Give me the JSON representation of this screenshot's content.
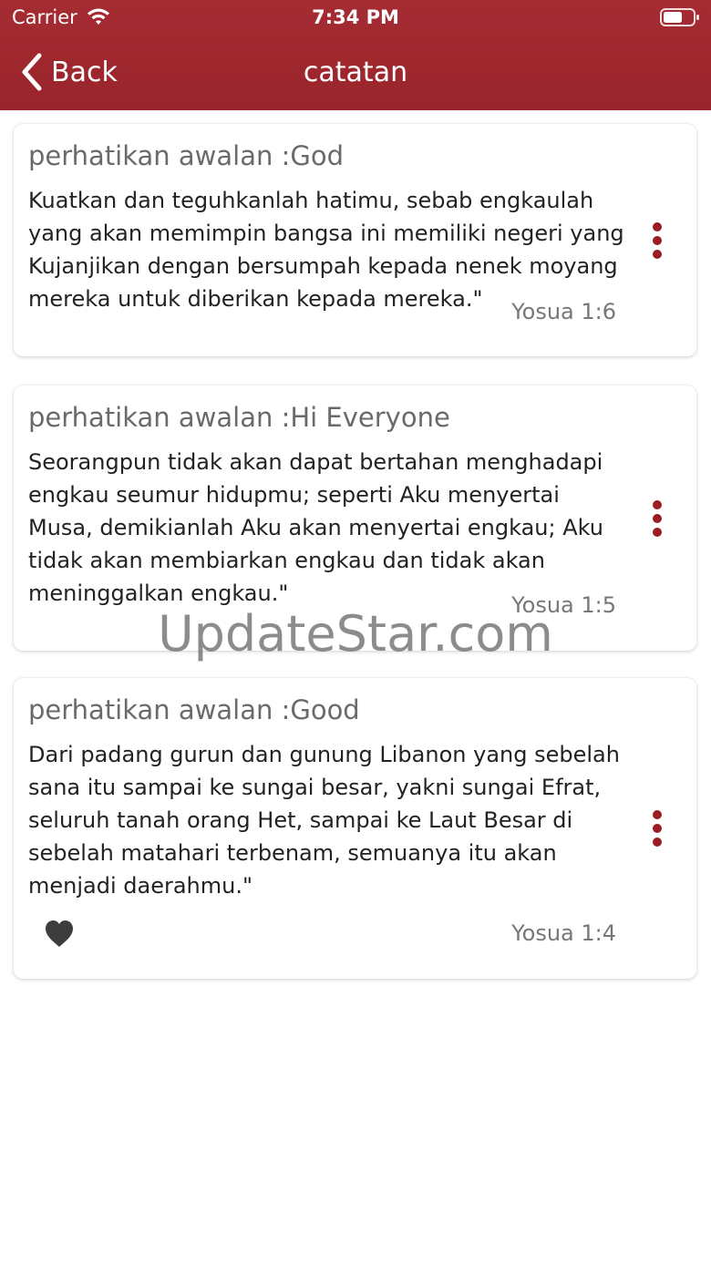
{
  "status_bar": {
    "carrier": "Carrier",
    "time": "7:34 PM",
    "icons": [
      "wifi-icon",
      "battery-icon"
    ]
  },
  "nav": {
    "back_label": "Back",
    "title": "catatan",
    "back_icon": "chevron-left-icon"
  },
  "notes": [
    {
      "title": "perhatikan awalan :God",
      "text": "Kuatkan dan teguhkanlah hatimu, sebab engkaulah yang akan memimpin bangsa ini memiliki negeri yang Kujanjikan dengan bersumpah kepada nenek moyang mereka untuk diberikan kepada mereka.\"",
      "reference": "Yosua 1:6",
      "favorite": false
    },
    {
      "title": "perhatikan awalan :Hi Everyone",
      "text": "Seorangpun tidak akan dapat bertahan menghadapi engkau seumur hidupmu; seperti Aku menyertai Musa, demikianlah Aku akan menyertai engkau; Aku tidak akan membiarkan engkau dan tidak akan meninggalkan engkau.\"",
      "reference": "Yosua 1:5",
      "favorite": false
    },
    {
      "title": "perhatikan awalan :Good",
      "text": "Dari padang gurun dan gunung Libanon yang sebelah sana itu sampai ke sungai besar, yakni sungai Efrat, seluruh tanah orang Het, sampai ke Laut Besar di sebelah matahari terbenam, semuanya itu akan menjadi daerahmu.\"",
      "reference": "Yosua 1:4",
      "favorite": true
    }
  ],
  "watermark": "UpdateStar.com",
  "colors": {
    "header": "#a0282f",
    "accent": "#9b1c22",
    "text": "#222222",
    "muted": "#777777"
  }
}
